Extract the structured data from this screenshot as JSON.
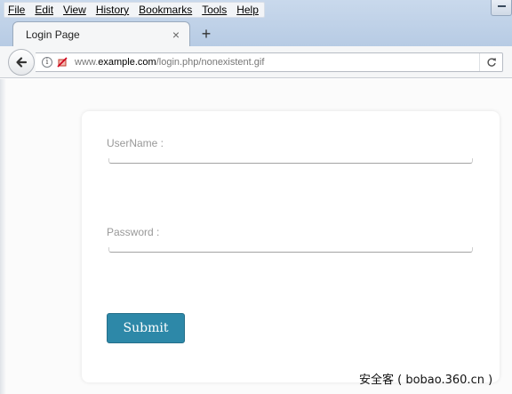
{
  "menubar": {
    "items": [
      "File",
      "Edit",
      "View",
      "History",
      "Bookmarks",
      "Tools",
      "Help"
    ]
  },
  "tab": {
    "title": "Login Page",
    "close_label": "×",
    "new_tab_label": "+"
  },
  "urlbar": {
    "prefix": "www.",
    "host": "example.com",
    "path": "/login.php/nonexistent.gif"
  },
  "icons": {
    "back": "back-arrow-icon",
    "info": "info-icon",
    "mixed_content": "mixed-content-blocked-icon",
    "reload": "reload-icon"
  },
  "form": {
    "username_label": "UserName :",
    "username_value": "",
    "password_label": "Password :",
    "password_value": "",
    "submit_label": "Submit"
  },
  "watermark": "安全客 ( bobao.360.cn )",
  "colors": {
    "submit_bg": "#2d88a8",
    "label_text": "#999999",
    "titlebar": "#c9d9ec"
  }
}
